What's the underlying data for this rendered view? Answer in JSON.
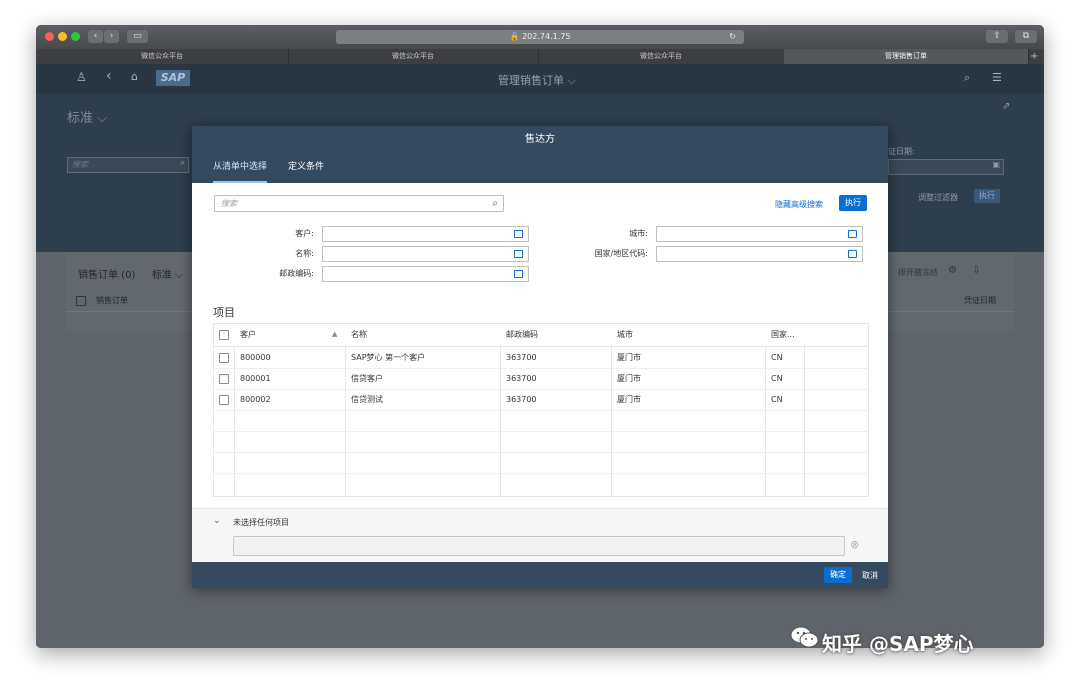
{
  "browser": {
    "url": "202.74.1.75",
    "tabs": [
      "微信公众平台",
      "微信公众平台",
      "微信公众平台",
      "管理销售订单"
    ]
  },
  "shell": {
    "logo": "SAP",
    "app_title": "管理销售订单"
  },
  "filterbar": {
    "variant": "标准",
    "search_placeholder": "搜索",
    "date_label": "证日期:",
    "adapt_filters": "调整过滤器",
    "go": "执行"
  },
  "content": {
    "table_title": "销售订单 (0)",
    "variant": "标准",
    "col_order": "销售订单",
    "col_date": "凭证日期",
    "partial_text": "排开腋冻结"
  },
  "dialog": {
    "title": "售达方",
    "tabs": [
      "从清单中选择",
      "定义条件"
    ],
    "search_placeholder": "搜索",
    "hide_advanced": "隐藏高级搜索",
    "go": "执行",
    "fields": {
      "customer": "客户:",
      "name": "名称:",
      "postal": "邮政编码:",
      "city": "城市:",
      "country": "国家/地区代码:"
    },
    "items_title": "项目",
    "columns": [
      "客户",
      "名称",
      "邮政编码",
      "城市",
      "国家..."
    ],
    "rows": [
      {
        "customer": "800000",
        "name": "SAP梦心 第一个客户",
        "postal": "363700",
        "city": "厦门市",
        "country": "CN"
      },
      {
        "customer": "800001",
        "name": "信贷客户",
        "postal": "363700",
        "city": "厦门市",
        "country": "CN"
      },
      {
        "customer": "800002",
        "name": "信贷测试",
        "postal": "363700",
        "city": "厦门市",
        "country": "CN"
      }
    ],
    "selected_summary": "未选择任何项目",
    "ok": "确定",
    "cancel": "取消"
  },
  "watermark": "知乎 @SAP梦心",
  "colors": {
    "shell": "#2a3642",
    "dialog_header": "#354a5f",
    "accent": "#0a6ed1"
  }
}
